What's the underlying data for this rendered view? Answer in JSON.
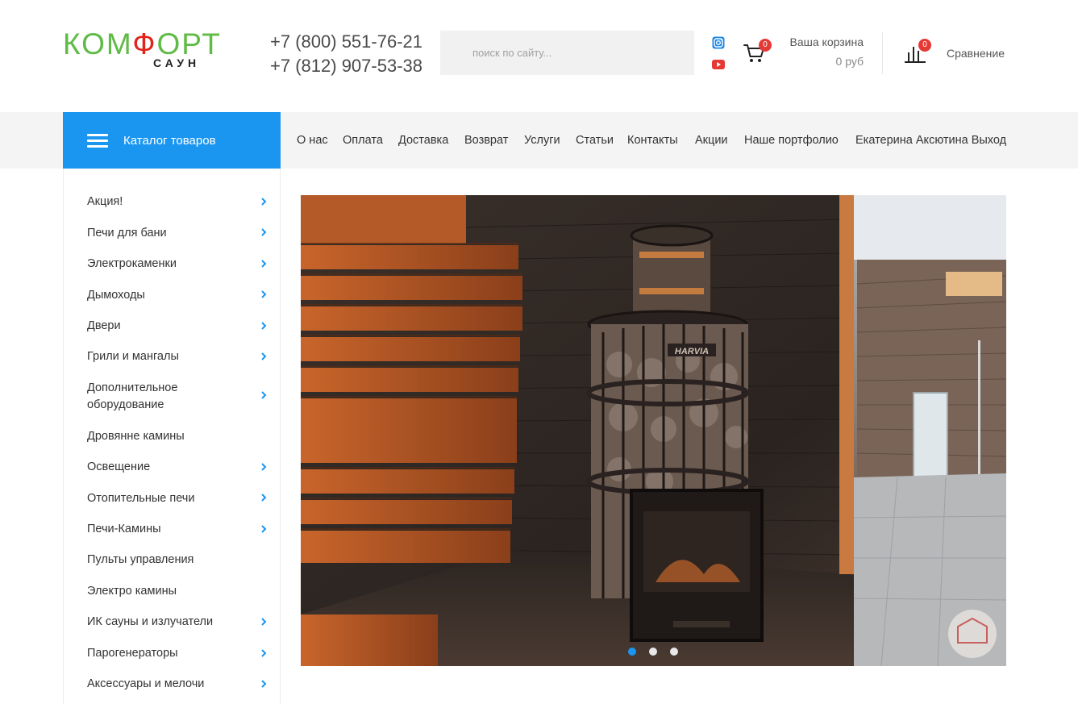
{
  "header": {
    "logo_main_start": "КОМ",
    "logo_main_flame": "Ф",
    "logo_main_end": "ОРТ",
    "logo_sub": "САУН",
    "phones": [
      "+7 (800) 551-76-21",
      "+7 (812) 907-53-38"
    ],
    "search_placeholder": "поиск по сайту...",
    "social": [
      "instagram-icon",
      "youtube-icon"
    ],
    "cart": {
      "label": "Ваша корзина",
      "total": "0 руб",
      "count": "0"
    },
    "compare": {
      "label": "Сравнение",
      "count": "0"
    }
  },
  "nav": {
    "catalog_label": "Каталог товаров",
    "items": [
      "О нас",
      "Оплата",
      "Доставка",
      "Возврат",
      "Услуги",
      "Статьи",
      "Контакты",
      "Акции",
      "Наше портфолио",
      "Екатерина Аксютина Выход"
    ]
  },
  "sidebar": {
    "items": [
      {
        "label": "Акция!",
        "has_children": true
      },
      {
        "label": "Печи для бани",
        "has_children": true
      },
      {
        "label": "Электрокаменки",
        "has_children": true
      },
      {
        "label": "Дымоходы",
        "has_children": true
      },
      {
        "label": "Двери",
        "has_children": true
      },
      {
        "label": "Грили и мангалы",
        "has_children": true
      },
      {
        "label": "Дополнительное оборудование",
        "has_children": true
      },
      {
        "label": "Дровянне камины",
        "has_children": false
      },
      {
        "label": "Освещение",
        "has_children": true
      },
      {
        "label": "Отопительные печи",
        "has_children": true
      },
      {
        "label": "Печи-Камины",
        "has_children": true
      },
      {
        "label": "Пульты управления",
        "has_children": false
      },
      {
        "label": "Электро камины",
        "has_children": false
      },
      {
        "label": "ИК сауны и излучатели",
        "has_children": true
      },
      {
        "label": "Парогенераторы",
        "has_children": true
      },
      {
        "label": "Аксессуары и мелочи",
        "has_children": true
      }
    ]
  },
  "slider": {
    "slide_count": 3,
    "active_index": 0,
    "heater_brand": "HARVIA"
  },
  "colors": {
    "accent": "#1a96f0",
    "logo_green": "#5fbb46",
    "badge_red": "#e53935"
  }
}
